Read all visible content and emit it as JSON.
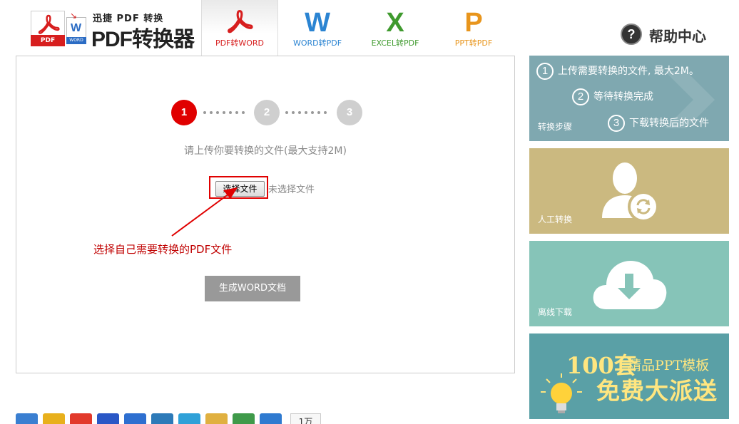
{
  "logo": {
    "subtitle": "迅捷 PDF 转换",
    "title": "PDF转换器",
    "pdf_badge": "PDF",
    "word_badge": "WORD",
    "word_letter": "W"
  },
  "tabs": [
    {
      "label": "PDF转WORD",
      "color": "#d71e1e",
      "active": true
    },
    {
      "label": "WORD转PDF",
      "glyph": "W",
      "color": "#2b84d2",
      "active": false
    },
    {
      "label": "EXCEL转PDF",
      "glyph": "X",
      "color": "#3f9a2e",
      "active": false
    },
    {
      "label": "PPT转PDF",
      "glyph": "P",
      "color": "#e8951c",
      "active": false
    }
  ],
  "help": {
    "icon": "?",
    "label": "帮助中心"
  },
  "steps": [
    "1",
    "2",
    "3"
  ],
  "upload": {
    "hint": "请上传你要转换的文件(最大支持2M)",
    "choose_label": "选择文件",
    "no_file": "未选择文件",
    "annotation": "选择自己需要转换的PDF文件",
    "generate_label": "生成WORD文档"
  },
  "sidebar": {
    "steps_panel": {
      "step1": "上传需要转换的文件, 最大2M。",
      "step2": "等待转换完成",
      "step3": "下载转换后的文件",
      "label": "转换步骤",
      "n1": "1",
      "n2": "2",
      "n3": "3"
    },
    "manual": {
      "label": "人工转换"
    },
    "offline": {
      "label": "离线下载"
    },
    "promo": {
      "count": "100套",
      "sub": "精品PPT模板",
      "headline": "免费大派送"
    }
  },
  "share": {
    "count": "1万"
  },
  "colors": {
    "accent_red": "#e00000",
    "steps_bg": "#7fa8b0",
    "manual_bg": "#cbb980",
    "offline_bg": "#86c4b8",
    "promo_bg": "#5aa0a6"
  }
}
